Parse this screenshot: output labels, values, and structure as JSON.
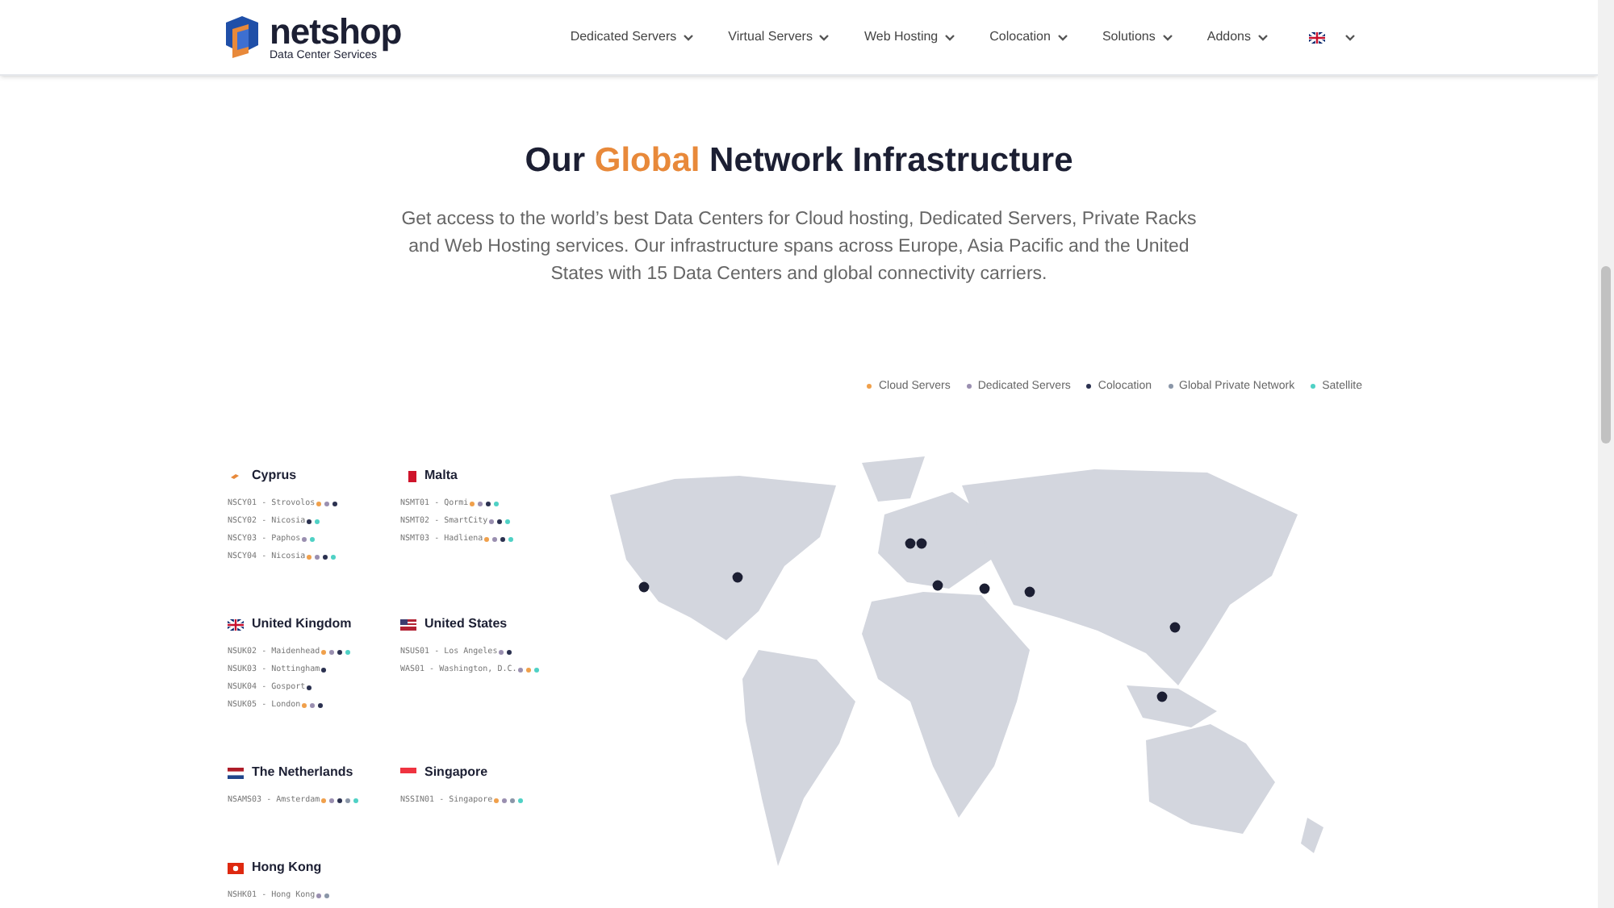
{
  "header": {
    "logo": {
      "name": "netshop",
      "tagline": "Data Center Services"
    },
    "nav": [
      {
        "label": "Dedicated Servers"
      },
      {
        "label": "Virtual Servers"
      },
      {
        "label": "Web Hosting"
      },
      {
        "label": "Colocation"
      },
      {
        "label": "Solutions"
      },
      {
        "label": "Addons"
      }
    ]
  },
  "hero": {
    "title_before": "Our ",
    "title_highlight": "Global",
    "title_after": " Network Infrastructure",
    "description": "Get access to the world’s best Data Centers for Cloud hosting, Dedicated Servers, Private Racks and Web Hosting services. Our infrastructure spans across Europe, Asia Pacific and the United States with 15 Data Centers and global connectivity carriers."
  },
  "legend": [
    {
      "label": "Cloud Servers",
      "color": "#f0a04b"
    },
    {
      "label": "Dedicated Servers",
      "color": "#9a8fb0"
    },
    {
      "label": "Colocation",
      "color": "#2b3150"
    },
    {
      "label": "Global Private Network",
      "color": "#8a96a8"
    },
    {
      "label": "Satellite",
      "color": "#4fd1c5"
    }
  ],
  "countries": [
    {
      "name": "Cyprus",
      "sites": [
        {
          "code": "NSCY01 - Strovolos",
          "dots": [
            {
              "color": "#f0a04b"
            },
            {
              "color": "#9a8fb0"
            },
            {
              "color": "#2b3150"
            }
          ]
        },
        {
          "code": "NSCY02 - Nicosia",
          "dots": [
            {
              "color": "#2b3150"
            },
            {
              "color": "#4fd1c5"
            }
          ]
        },
        {
          "code": "NSCY03 - Paphos",
          "dots": [
            {
              "color": "#9a8fb0"
            },
            {
              "color": "#4fd1c5"
            }
          ]
        },
        {
          "code": "NSCY04 - Nicosia",
          "dots": [
            {
              "color": "#f0a04b"
            },
            {
              "color": "#9a8fb0"
            },
            {
              "color": "#2b3150"
            },
            {
              "color": "#4fd1c5"
            }
          ]
        }
      ]
    },
    {
      "name": "Malta",
      "sites": [
        {
          "code": "NSMT01 - Qormi",
          "dots": [
            {
              "color": "#f0a04b"
            },
            {
              "color": "#9a8fb0"
            },
            {
              "color": "#2b3150"
            },
            {
              "color": "#4fd1c5"
            }
          ]
        },
        {
          "code": "NSMT02 - SmartCity",
          "dots": [
            {
              "color": "#9a8fb0"
            },
            {
              "color": "#2b3150"
            },
            {
              "color": "#4fd1c5"
            }
          ]
        },
        {
          "code": "NSMT03 - Hadliena",
          "dots": [
            {
              "color": "#f0a04b"
            },
            {
              "color": "#9a8fb0"
            },
            {
              "color": "#2b3150"
            },
            {
              "color": "#4fd1c5"
            }
          ]
        }
      ]
    },
    {
      "name": "United Kingdom",
      "sites": [
        {
          "code": "NSUK02 - Maidenhead",
          "dots": [
            {
              "color": "#f0a04b"
            },
            {
              "color": "#9a8fb0"
            },
            {
              "color": "#2b3150"
            },
            {
              "color": "#4fd1c5"
            }
          ]
        },
        {
          "code": "NSUK03 - Nottingham",
          "dots": [
            {
              "color": "#2b3150"
            }
          ]
        },
        {
          "code": "NSUK04 - Gosport",
          "dots": [
            {
              "color": "#2b3150"
            }
          ]
        },
        {
          "code": "NSUK05 - London",
          "dots": [
            {
              "color": "#f0a04b"
            },
            {
              "color": "#9a8fb0"
            },
            {
              "color": "#2b3150"
            }
          ]
        }
      ]
    },
    {
      "name": "United States",
      "sites": [
        {
          "code": "NSUS01 - Los Angeles",
          "dots": [
            {
              "color": "#9a8fb0"
            },
            {
              "color": "#2b3150"
            }
          ]
        },
        {
          "code": "WAS01 - Washington, D.C.",
          "dots": [
            {
              "color": "#9a8fb0"
            },
            {
              "color": "#f0a04b"
            },
            {
              "color": "#4fd1c5"
            }
          ]
        }
      ]
    },
    {
      "name": "The Netherlands",
      "sites": [
        {
          "code": "NSAMS03 - Amsterdam",
          "dots": [
            {
              "color": "#f0a04b"
            },
            {
              "color": "#9a8fb0"
            },
            {
              "color": "#2b3150"
            },
            {
              "color": "#8a96a8"
            },
            {
              "color": "#4fd1c5"
            }
          ]
        }
      ]
    },
    {
      "name": "Singapore",
      "sites": [
        {
          "code": "NSSIN01 - Singapore",
          "dots": [
            {
              "color": "#f0a04b"
            },
            {
              "color": "#9a8fb0"
            },
            {
              "color": "#8a96a8"
            },
            {
              "color": "#4fd1c5"
            }
          ]
        }
      ]
    },
    {
      "name": "Hong Kong",
      "sites": [
        {
          "code": "NSHK01 - Hong Kong",
          "dots": [
            {
              "color": "#9a8fb0"
            },
            {
              "color": "#8a96a8"
            }
          ]
        }
      ]
    }
  ]
}
